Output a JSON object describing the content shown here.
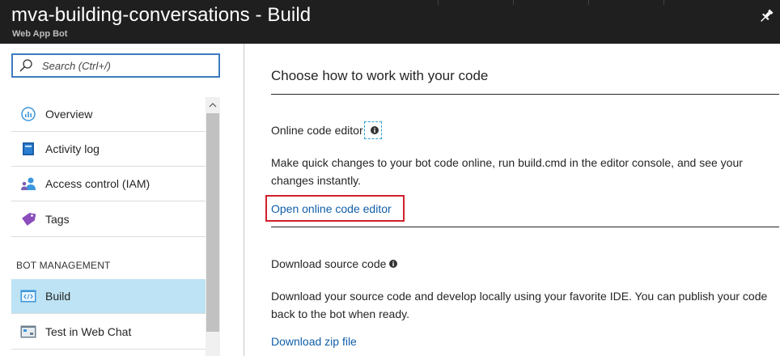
{
  "header": {
    "title": "mva-building-conversations - Build",
    "subtitle": "Web App Bot",
    "pin_icon": "pin-icon"
  },
  "sidebar": {
    "search": {
      "placeholder": "Search (Ctrl+/)",
      "value": "",
      "icon": "search-icon"
    },
    "items": [
      {
        "label": "Overview",
        "icon": "overview-icon"
      },
      {
        "label": "Activity log",
        "icon": "activity-log-icon"
      },
      {
        "label": "Access control (IAM)",
        "icon": "access-control-icon"
      },
      {
        "label": "Tags",
        "icon": "tag-icon"
      }
    ],
    "section_label": "BOT MANAGEMENT",
    "bot_items": [
      {
        "label": "Build",
        "icon": "code-icon",
        "selected": true
      },
      {
        "label": "Test in Web Chat",
        "icon": "web-chat-icon"
      }
    ]
  },
  "main": {
    "heading": "Choose how to work with your code",
    "online_editor": {
      "title": "Online code editor",
      "description": "Make quick changes to your bot code online, run build.cmd in the editor console, and see your changes instantly.",
      "link": "Open online code editor"
    },
    "download": {
      "title": "Download source code",
      "description": "Download your source code and develop locally using your favorite IDE. You can publish your code back to the bot when ready.",
      "link": "Download zip file"
    }
  },
  "colors": {
    "header_bg": "#1f1f1f",
    "link": "#0f5ea8",
    "selected_bg": "#bde3f4",
    "highlight_border": "#d0202b",
    "search_border": "#3d7bbf"
  }
}
